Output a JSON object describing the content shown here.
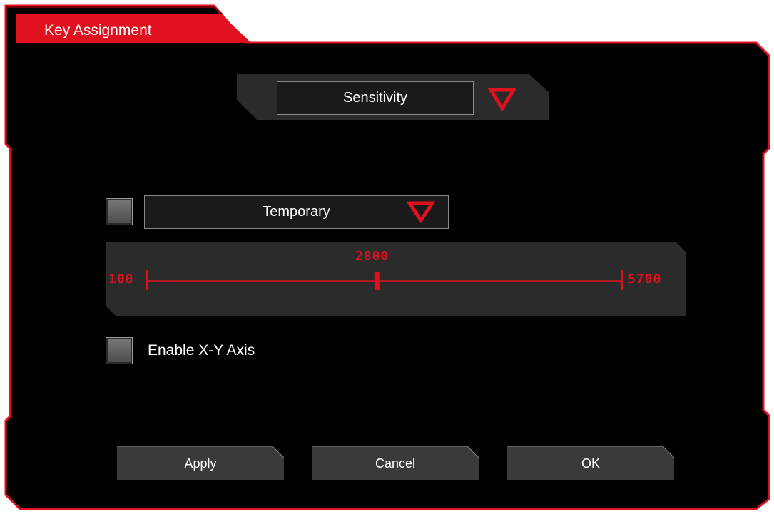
{
  "window": {
    "title": "Key Assignment"
  },
  "mode_select": {
    "value": "Sensitivity",
    "arrow_icon": "triangle-down-icon"
  },
  "temporary": {
    "checked": false,
    "select_value": "Temporary",
    "arrow_icon": "triangle-down-icon"
  },
  "slider": {
    "min_label": "100",
    "max_label": "5700",
    "value_label": "2800",
    "value_fraction": 0.484
  },
  "xy_axis": {
    "checked": false,
    "label": "Enable X-Y Axis"
  },
  "buttons": {
    "apply": "Apply",
    "cancel": "Cancel",
    "ok": "OK"
  },
  "colors": {
    "accent": "#e0101e",
    "background": "#000000",
    "panel": "#2b2b2b"
  }
}
